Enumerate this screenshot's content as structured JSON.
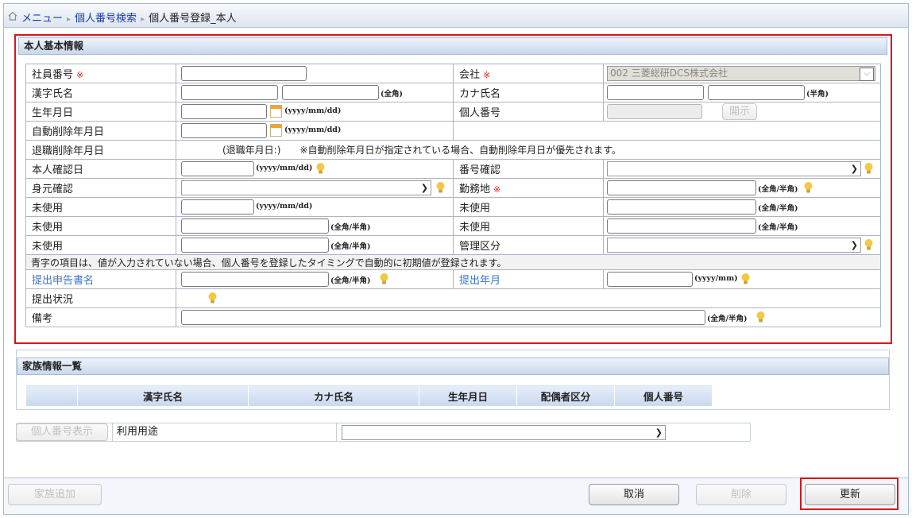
{
  "breadcrumb": {
    "items": [
      "メニュー",
      "個人番号検索"
    ],
    "current": "個人番号登録_本人"
  },
  "section_personal": {
    "title": "本人基本情報",
    "employee_no": "社員番号",
    "required_mark": "※",
    "company": "会社",
    "company_value": "002 三菱総研DCS株式会社",
    "kanji_name": "漢字氏名",
    "kana_name": "カナ氏名",
    "zenkaku": "(全角)",
    "hankaku": "(半角)",
    "birth_date": "生年月日",
    "date_hint": "(yyyy/mm/dd)",
    "my_number": "個人番号",
    "open_button": "開示",
    "auto_delete_date": "自動削除年月日",
    "retire_delete_date": "退職削除年月日",
    "retire_note": "(退職年月日:)　　※自動削除年月日が指定されている場合、自動削除年月日が優先されます。",
    "self_confirm_date": "本人確認日",
    "number_confirm": "番号確認",
    "identity_confirm": "身元確認",
    "workplace": "勤務地",
    "zen_han": "(全角/半角)",
    "unused": "未使用",
    "management_class": "管理区分",
    "blue_note": "青字の項目は、値が入力されていない場合、個人番号を登録したタイミングで自動的に初期値が登録されます。",
    "submit_form_name": "提出申告書名",
    "submit_year_month": "提出年月",
    "ym_hint": "(yyyy/mm)",
    "submit_status": "提出状況",
    "remarks": "備考"
  },
  "family": {
    "title": "家族情報一覧",
    "columns": [
      "漢字氏名",
      "カナ氏名",
      "生年月日",
      "配偶者区分",
      "個人番号"
    ]
  },
  "usage": {
    "show_button": "個人番号表示",
    "label": "利用用途"
  },
  "footer": {
    "add_family": "家族追加",
    "cancel": "取消",
    "delete": "削除",
    "update": "更新"
  },
  "colors": {
    "highlight": "#d8141b",
    "link": "#1a3aa8",
    "blue_label": "#3b73c8"
  }
}
